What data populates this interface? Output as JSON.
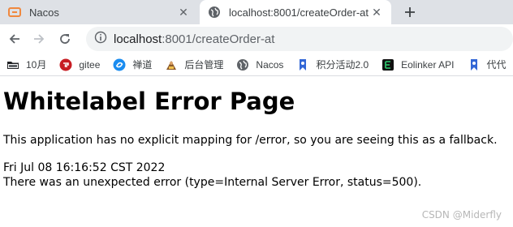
{
  "tabs": [
    {
      "title": "Nacos",
      "active": false,
      "icon": "nacos-icon"
    },
    {
      "title": "localhost:8001/createOrder-at",
      "active": true,
      "icon": "globe-icon"
    }
  ],
  "toolbar": {
    "url_host": "localhost",
    "url_path": ":8001/createOrder-at"
  },
  "bookmarks": [
    {
      "label": "10月",
      "icon": "folder-icon"
    },
    {
      "label": "gitee",
      "icon": "gitee-icon"
    },
    {
      "label": "禅道",
      "icon": "zentao-icon"
    },
    {
      "label": "后台管理",
      "icon": "admin-icon"
    },
    {
      "label": "Nacos",
      "icon": "globe-icon"
    },
    {
      "label": "积分活动2.0",
      "icon": "bookmark-blue-icon"
    },
    {
      "label": "Eolinker API",
      "icon": "eolinker-icon"
    },
    {
      "label": "代代",
      "icon": "bookmark-blue-icon"
    }
  ],
  "page": {
    "heading": "Whitelabel Error Page",
    "message": "This application has no explicit mapping for /error, so you are seeing this as a fallback.",
    "timestamp": "Fri Jul 08 16:16:52 CST 2022",
    "error": "There was an unexpected error (type=Internal Server Error, status=500)."
  },
  "watermark": "CSDN @Miderfly",
  "colors": {
    "tabstrip_bg": "#dee1e6",
    "omnibox_bg": "#f1f3f4",
    "nacos_orange": "#f0883e",
    "gitee_red": "#c71d23",
    "zentao_blue": "#1a8cf0",
    "eolinker_green": "#0f8a4f"
  }
}
